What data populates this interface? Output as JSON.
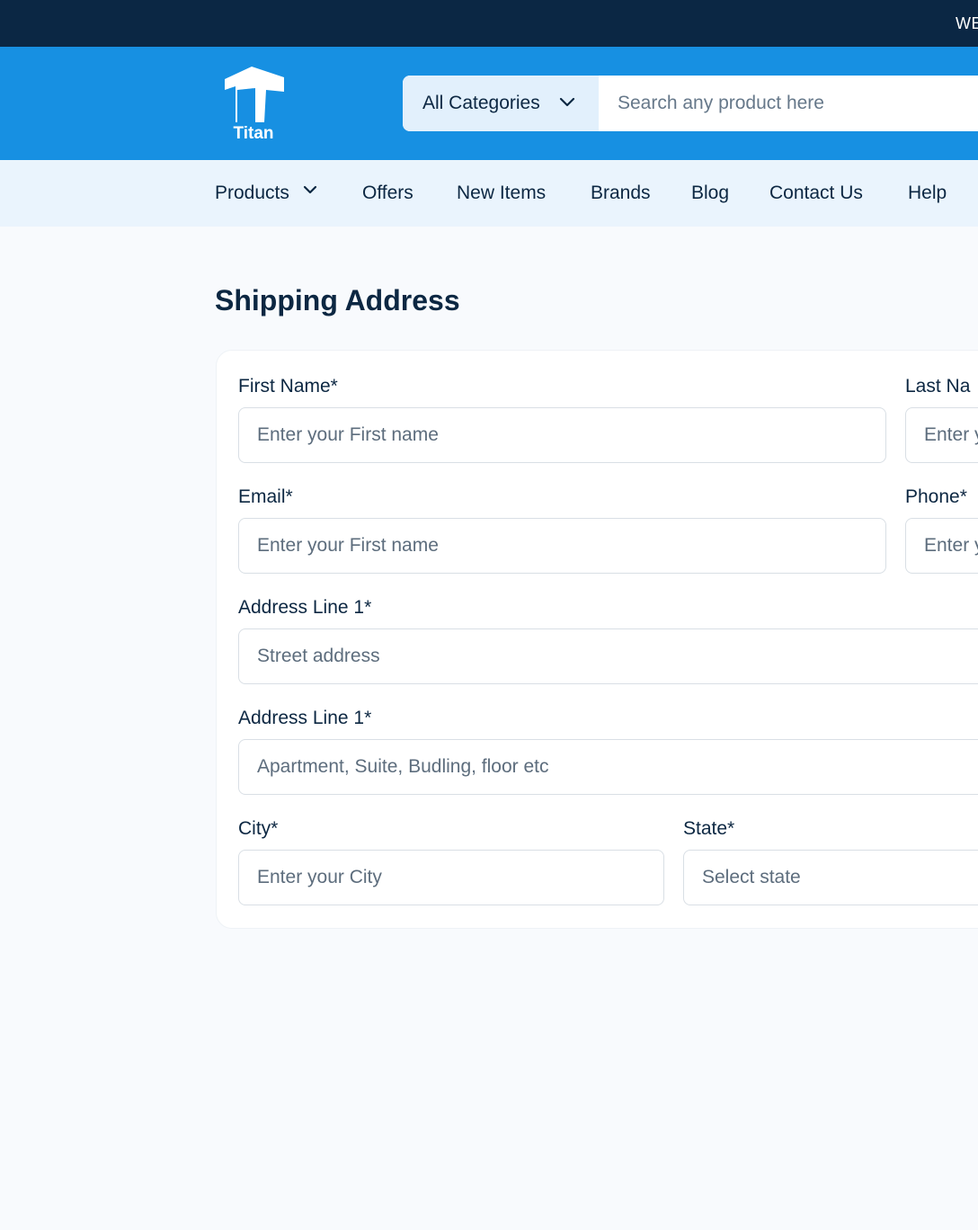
{
  "topbar": {
    "text": "WE"
  },
  "header": {
    "logo_text": "Titan",
    "search": {
      "category_label": "All Categories",
      "placeholder": "Search any product here"
    }
  },
  "nav": {
    "items": [
      {
        "label": "Products"
      },
      {
        "label": "Offers"
      },
      {
        "label": "New Items"
      },
      {
        "label": "Brands"
      },
      {
        "label": "Blog"
      },
      {
        "label": "Contact Us"
      },
      {
        "label": "Help"
      }
    ]
  },
  "page": {
    "title": "Shipping Address"
  },
  "form": {
    "first_name": {
      "label": "First Name*",
      "placeholder": "Enter your First name"
    },
    "last_name": {
      "label": "Last  Na",
      "placeholder": "Enter y"
    },
    "email": {
      "label": "Email*",
      "placeholder": "Enter your First name"
    },
    "phone": {
      "label": "Phone*",
      "placeholder": "Enter y"
    },
    "address1": {
      "label": "Address Line 1*",
      "placeholder": "Street address"
    },
    "address2": {
      "label": "Address Line 1*",
      "placeholder": "Apartment, Suite, Budling, floor etc"
    },
    "city": {
      "label": "City*",
      "placeholder": "Enter your City"
    },
    "state": {
      "label": "State*",
      "placeholder": "Select state"
    }
  },
  "colors": {
    "topbar": "#0b2744",
    "header": "#1790e2",
    "nav": "#eaf4fd",
    "text": "#0c2742"
  }
}
